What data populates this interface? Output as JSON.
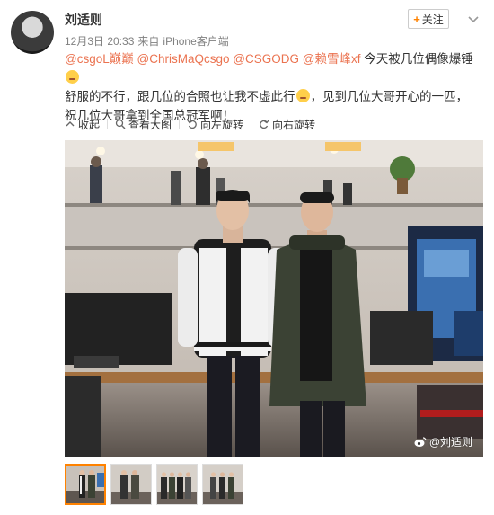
{
  "post": {
    "username": "刘适则",
    "date": "12月3日 20:33",
    "source_prefix": "来自",
    "source": "iPhone客户端",
    "follow_label": "关注",
    "mentions": [
      "@csgoL巅巅",
      "@ChrisMaQcsgo",
      "@CSGODG",
      "@赖雪峰xf"
    ],
    "text_part1": " 今天被几位偶像爆锤",
    "text_part2": "舒服的不行，跟几位的合照也让我不虚此行",
    "text_part3": "，见到几位大哥开心的一匹，祝几位大哥拿到全国总冠军啊！"
  },
  "toolbar": {
    "collapse_label": "收起",
    "view_large_label": "查看大图",
    "rotate_left_label": "向左旋转",
    "rotate_right_label": "向右旋转"
  },
  "photo": {
    "watermark_handle": "@刘适则"
  },
  "thumbnails": [
    {
      "selected": true
    },
    {
      "selected": false
    },
    {
      "selected": false
    },
    {
      "selected": false
    }
  ],
  "colors": {
    "mention": "#eb7350",
    "accent": "#ff8200"
  }
}
